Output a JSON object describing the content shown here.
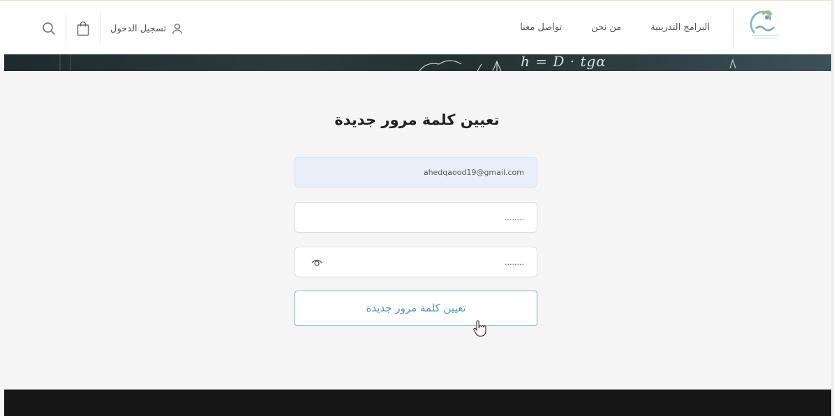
{
  "header": {
    "nav": [
      {
        "label": "البرامج التدريبية"
      },
      {
        "label": "من نحن"
      },
      {
        "label": "تواصل معنا"
      }
    ],
    "login_label": "تسجيل الدخول",
    "icons": {
      "search": "search-icon",
      "cart": "shopping-bag-icon",
      "user": "user-icon"
    }
  },
  "hero": {
    "formula": "h = D · tgα"
  },
  "form": {
    "title": "تعيين كلمة مرور جديدة",
    "email_value": "ahedqaood19@gmail.com",
    "password_value": "........",
    "confirm_value": "........",
    "submit_label": "تعيين كلمة مرور جديدة"
  },
  "colors": {
    "accent": "#4d96bd",
    "email_bg": "#e9eff8",
    "footer": "#161616"
  }
}
